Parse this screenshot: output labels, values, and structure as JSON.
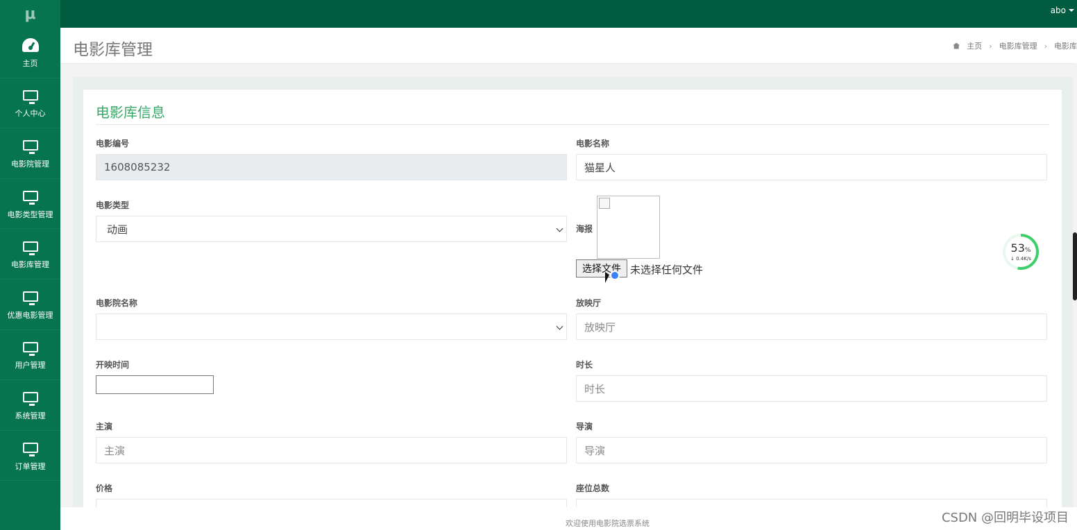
{
  "app": {
    "logo": "μ",
    "user": "abo"
  },
  "sidebar": {
    "items": [
      {
        "label": "主页",
        "icon": "dashboard-icon"
      },
      {
        "label": "个人中心",
        "icon": "monitor-icon"
      },
      {
        "label": "电影院管理",
        "icon": "monitor-icon"
      },
      {
        "label": "电影类型管理",
        "icon": "monitor-icon"
      },
      {
        "label": "电影库管理",
        "icon": "monitor-icon"
      },
      {
        "label": "优惠电影管理",
        "icon": "monitor-icon"
      },
      {
        "label": "用户管理",
        "icon": "monitor-icon"
      },
      {
        "label": "系统管理",
        "icon": "monitor-icon"
      },
      {
        "label": "订单管理",
        "icon": "monitor-icon"
      }
    ]
  },
  "header": {
    "title": "电影库管理",
    "breadcrumb": [
      "主页",
      "电影库管理",
      "电影库"
    ]
  },
  "form": {
    "title": "电影库信息",
    "movie_no": {
      "label": "电影编号",
      "value": "1608085232"
    },
    "movie_name": {
      "label": "电影名称",
      "value": "猫星人"
    },
    "movie_type": {
      "label": "电影类型",
      "value": "动画"
    },
    "poster": {
      "label": "海报",
      "button": "选择文件",
      "status": "未选择任何文件"
    },
    "cinema_name": {
      "label": "电影院名称",
      "value": ""
    },
    "hall": {
      "label": "放映厅",
      "placeholder": "放映厅"
    },
    "show_time": {
      "label": "开映时间",
      "value": ""
    },
    "duration": {
      "label": "时长",
      "placeholder": "时长"
    },
    "actors": {
      "label": "主演",
      "placeholder": "主演"
    },
    "director": {
      "label": "导演",
      "placeholder": "导演"
    },
    "price": {
      "label": "价格"
    },
    "seats": {
      "label": "座位总数"
    }
  },
  "network_widget": {
    "percent": "53",
    "percent_unit": "%",
    "rate": "↓ 0.4K/s"
  },
  "footer": {
    "text": "欢迎使用电影院选票系统"
  },
  "watermark": "CSDN @回明毕设项目",
  "colors": {
    "topbar": "#005b3f",
    "sidebar": "#05744f",
    "accent": "#3aa867"
  }
}
